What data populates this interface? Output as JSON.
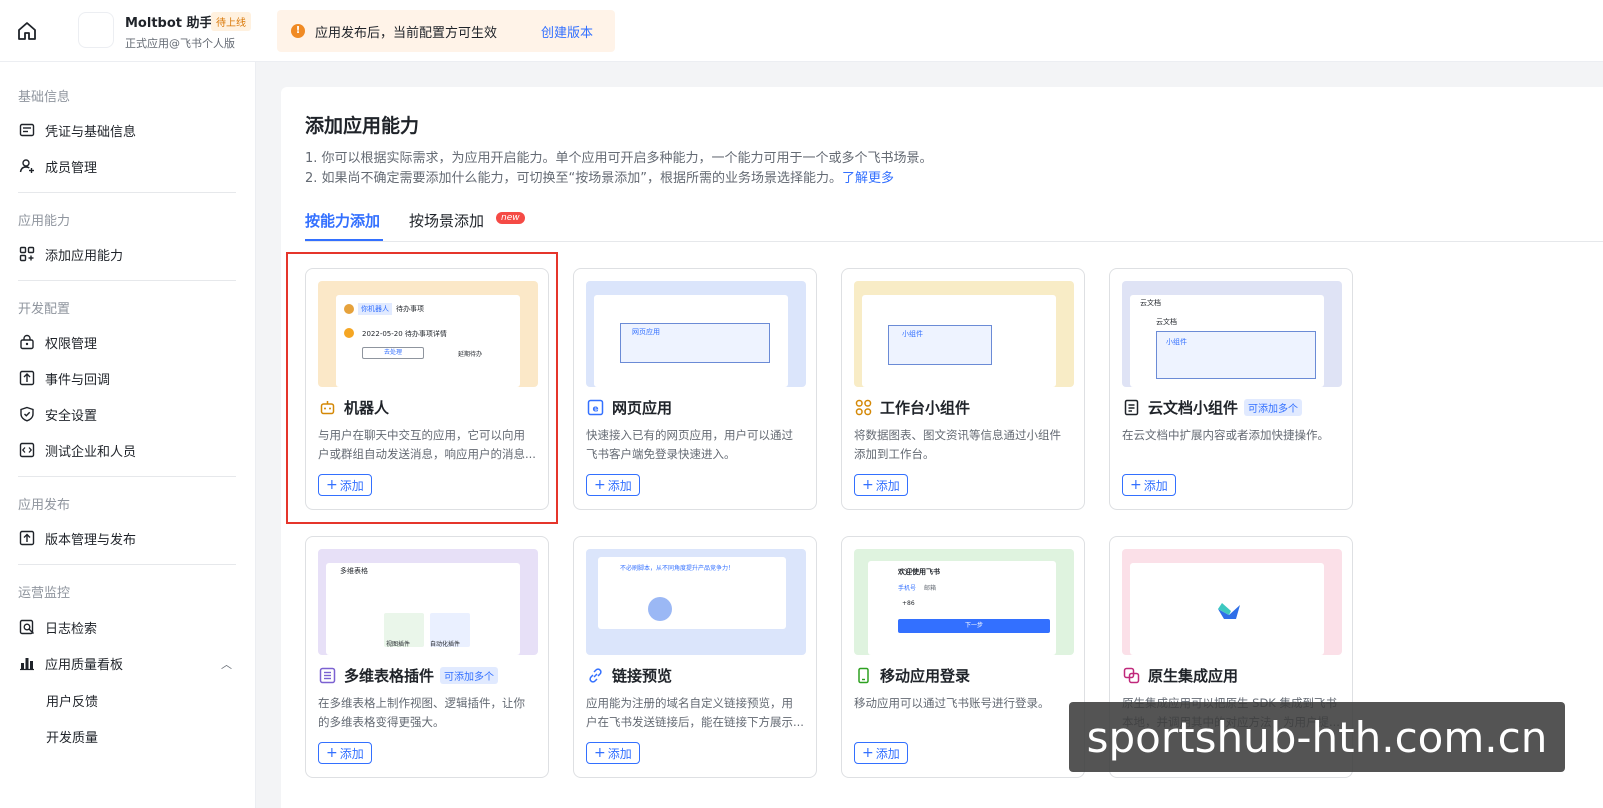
{
  "header": {
    "app_name": "Moltbot 助手",
    "app_badge": "待上线",
    "app_sub": "正式应用@飞书个人版",
    "banner_text": "应用发布后，当前配置方可生效",
    "banner_link": "创建版本",
    "colors": {
      "banner_bg": "#fff3e8",
      "warn": "#f08a24",
      "accent": "#3370ff"
    }
  },
  "sidebar": {
    "groups": [
      {
        "label": "基础信息",
        "items": [
          {
            "label": "凭证与基础信息",
            "icon": "id-card-icon"
          },
          {
            "label": "成员管理",
            "icon": "user-add-icon"
          }
        ]
      },
      {
        "label": "应用能力",
        "items": [
          {
            "label": "添加应用能力",
            "icon": "grid-add-icon"
          }
        ]
      },
      {
        "label": "开发配置",
        "items": [
          {
            "label": "权限管理",
            "icon": "lock-icon"
          },
          {
            "label": "事件与回调",
            "icon": "event-icon"
          },
          {
            "label": "安全设置",
            "icon": "shield-icon"
          },
          {
            "label": "测试企业和人员",
            "icon": "code-icon"
          }
        ]
      },
      {
        "label": "应用发布",
        "items": [
          {
            "label": "版本管理与发布",
            "icon": "upload-icon"
          }
        ]
      },
      {
        "label": "运营监控",
        "items": [
          {
            "label": "日志检索",
            "icon": "search-doc-icon"
          },
          {
            "label": "应用质量看板",
            "icon": "bar-chart-icon"
          },
          {
            "label": "用户反馈"
          },
          {
            "label": "开发质量"
          }
        ]
      }
    ]
  },
  "main": {
    "title": "添加应用能力",
    "desc1": "1. 你可以根据实际需求，为应用开启能力。单个应用可开启多种能力，一个能力可用于一个或多个飞书场景。",
    "desc2": "2. 如果尚不确定需要添加什么能力，可切换至“按场景添加”，根据所需的业务场景选择能力。",
    "desc2_link": "了解更多",
    "tabs": [
      {
        "label": "按能力添加",
        "active": true
      },
      {
        "label": "按场景添加",
        "badge": "new"
      }
    ],
    "add_label": "添加",
    "cards": [
      {
        "title": "机器人",
        "icon": "robot-icon",
        "desc": "与用户在聊天中交互的应用，它可以向用户或群组自动发送消息，响应用户的消息...",
        "preview_color": "#fbe8c8",
        "preview_texts": [
          "你机器人",
          "待办事项",
          "2022-05-20  待办事项详情",
          "去处理",
          "延期待办"
        ]
      },
      {
        "title": "网页应用",
        "icon": "web-icon",
        "desc": "快速接入已有的网页应用，用户可以通过飞书客户端免登录快速进入。",
        "preview_color": "#dbe5fb",
        "preview_texts": [
          "网页应用"
        ]
      },
      {
        "title": "工作台小组件",
        "icon": "widget-icon",
        "desc": "将数据图表、图文资讯等信息通过小组件添加到工作台。",
        "preview_color": "#f8ecc6",
        "preview_texts": [
          "小组件"
        ]
      },
      {
        "title": "云文档小组件",
        "icon": "doc-icon",
        "pill": "可添加多个",
        "desc": "在云文档中扩展内容或者添加快捷操作。",
        "preview_color": "#dfe3f5",
        "preview_texts": [
          "云文档",
          "云文档",
          "小组件"
        ]
      },
      {
        "title": "多维表格插件",
        "icon": "table-icon",
        "pill": "可添加多个",
        "desc": "在多维表格上制作视图、逻辑插件，让你的多维表格变得更强大。",
        "preview_color": "#e7e0f7",
        "preview_texts": [
          "多维表格",
          "视图插件",
          "自动化插件"
        ]
      },
      {
        "title": "链接预览",
        "icon": "link-icon",
        "desc": "应用能为注册的域名自定义链接预览，用户在飞书发送链接后，能在链接下方展示...",
        "preview_color": "#dbe5fb",
        "preview_texts": [
          "不必刷脚本，从不同角度提升产品竞争力！"
        ]
      },
      {
        "title": "移动应用登录",
        "icon": "mobile-icon",
        "desc": "移动应用可以通过飞书账号进行登录。",
        "preview_color": "#dff3df",
        "preview_texts": [
          "欢迎使用飞书",
          "手机号",
          "邮箱",
          "+86",
          "下一步"
        ]
      },
      {
        "title": "原生集成应用",
        "icon": "native-icon",
        "desc": "原生集成应用可以把原生 SDK 集成到飞书本地，并调用其中的对应方法，为用户提...",
        "preview_color": "#fbe0e8",
        "preview_texts": []
      }
    ]
  },
  "watermark": "sportshub-hth.com.cn"
}
